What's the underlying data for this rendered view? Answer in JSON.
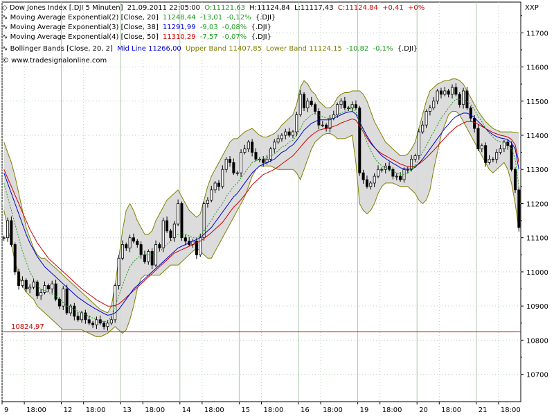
{
  "header": {
    "instrument_line": {
      "name": "Dow Jones Index [.DJI  5 Minuten]",
      "datetime": "21.09.2011 22:05:00",
      "open": "O:11121,63",
      "high": "H:11124,84",
      "low": "L:11117,43",
      "close": "C:11124,84",
      "change": "+0,41",
      "change_pct": "+0%"
    },
    "indicators": [
      {
        "label": "Moving Average Exponential(2) [Close, 20]",
        "value": "11248,44",
        "change": "-13,01",
        "change_pct": "-0,12%",
        "symbol": "{.DJI}",
        "color": "#1a9a1a"
      },
      {
        "label": "Moving Average Exponential(3) [Close, 38]",
        "value": "11291,99",
        "change": "-9,03",
        "change_pct": "-0,08%",
        "symbol": "{.DJI}",
        "color": "#0000d0"
      },
      {
        "label": "Moving Average Exponential(4) [Close, 50]",
        "value": "11310,29",
        "change": "-7,57",
        "change_pct": "-0,07%",
        "symbol": "{.DJI}",
        "color": "#cc0000"
      }
    ],
    "bollinger": {
      "label": "Bollinger Bands [Close, 20, 2]",
      "mid": "Mid Line 11266,00",
      "upper": "Upper Band 11407,85",
      "lower": "Lower Band 11124,15",
      "change": "-10,82",
      "change_pct": "-0,1%",
      "symbol": "{.DJI}",
      "mid_color": "#0000d0",
      "band_color": "#808000"
    },
    "copyright": "© www.tradesignalonline.com",
    "axis_tag": "XXP"
  },
  "chart_data": {
    "type": "line",
    "title": "Dow Jones Index [.DJI  5 Minuten]",
    "ylim": [
      10620,
      11790
    ],
    "y_ticks": [
      10700,
      10800,
      10900,
      11000,
      11100,
      11200,
      11300,
      11400,
      11500,
      11600,
      11700
    ],
    "y_tick_labels": [
      "10700",
      "10800",
      "10900",
      "11000",
      "11100",
      "11200",
      "11300",
      "11400",
      "11500",
      "11600",
      "11700"
    ],
    "x_ticks": [
      "9",
      "18:00",
      "12",
      "18:00",
      "13",
      "18:00",
      "14",
      "18:00",
      "15",
      "18:00",
      "16",
      "18:00",
      "19",
      "18:00",
      "20",
      "18:00",
      "21",
      "18:00"
    ],
    "x_tick_index": [
      0,
      6,
      16,
      22,
      32,
      38,
      48,
      54,
      64,
      70,
      80,
      86,
      96,
      102,
      112,
      118,
      128,
      134
    ],
    "day_separator_index": [
      16,
      32,
      48,
      64,
      80,
      96,
      112,
      128
    ],
    "grid": true,
    "reference_line": {
      "value": 10824.97,
      "label": "10824,97",
      "color": "#cc0000"
    },
    "series": [
      {
        "name": "Close",
        "color": "#000000",
        "values": [
          11100,
          11150,
          11080,
          11000,
          10960,
          10975,
          10950,
          10955,
          10970,
          10930,
          10940,
          10960,
          10950,
          10965,
          10920,
          10900,
          10950,
          10880,
          10900,
          10870,
          10860,
          10880,
          10860,
          10850,
          10845,
          10860,
          10850,
          10840,
          10850,
          10860,
          10960,
          11040,
          11080,
          11070,
          11100,
          11090,
          11080,
          11050,
          11030,
          11060,
          11020,
          11080,
          11070,
          11150,
          11120,
          11100,
          11140,
          11200,
          11100,
          11090,
          11080,
          11090,
          11050,
          11100,
          11200,
          11210,
          11240,
          11260,
          11250,
          11300,
          11330,
          11320,
          11290,
          11290,
          11350,
          11360,
          11380,
          11350,
          11330,
          11330,
          11320,
          11330,
          11360,
          11380,
          11390,
          11400,
          11410,
          11400,
          11410,
          11460,
          11520,
          11480,
          11500,
          11490,
          11470,
          11430,
          11430,
          11420,
          11450,
          11460,
          11490,
          11500,
          11480,
          11480,
          11490,
          11480,
          11290,
          11270,
          11250,
          11260,
          11280,
          11300,
          11300,
          11310,
          11300,
          11280,
          11280,
          11270,
          11300,
          11300,
          11330,
          11340,
          11410,
          11430,
          11470,
          11480,
          11500,
          11530,
          11520,
          11530,
          11520,
          11540,
          11520,
          11490,
          11530,
          11480,
          11450,
          11420,
          11360,
          11370,
          11320,
          11330,
          11330,
          11350,
          11360,
          11380,
          11370,
          11300,
          11240,
          11130
        ]
      },
      {
        "name": "Moving Average Exponential(2) [Close, 20]",
        "color": "#1a9a1a",
        "values": [
          11260,
          11220,
          11180,
          11140,
          11100,
          11060,
          11030,
          11000,
          10980,
          10960,
          10950,
          10945,
          10940,
          10935,
          10930,
          10920,
          10910,
          10900,
          10895,
          10890,
          10885,
          10880,
          10875,
          10870,
          10865,
          10860,
          10855,
          10855,
          10855,
          10870,
          10900,
          10930,
          10960,
          10990,
          11015,
          11030,
          11040,
          11050,
          11050,
          11050,
          11050,
          11055,
          11060,
          11070,
          11080,
          11090,
          11100,
          11110,
          11110,
          11110,
          11105,
          11100,
          11100,
          11105,
          11120,
          11135,
          11150,
          11170,
          11185,
          11200,
          11220,
          11235,
          11250,
          11260,
          11275,
          11290,
          11305,
          11320,
          11325,
          11330,
          11330,
          11335,
          11340,
          11345,
          11355,
          11365,
          11370,
          11380,
          11385,
          11400,
          11420,
          11440,
          11450,
          11460,
          11465,
          11460,
          11455,
          11450,
          11450,
          11455,
          11460,
          11465,
          11470,
          11475,
          11480,
          11470,
          11440,
          11410,
          11380,
          11355,
          11335,
          11320,
          11310,
          11305,
          11300,
          11295,
          11290,
          11285,
          11285,
          11290,
          11300,
          11310,
          11330,
          11350,
          11370,
          11390,
          11410,
          11430,
          11450,
          11465,
          11480,
          11495,
          11505,
          11505,
          11505,
          11500,
          11490,
          11475,
          11455,
          11440,
          11420,
          11405,
          11395,
          11385,
          11380,
          11380,
          11375,
          11360,
          11330,
          11250
        ]
      },
      {
        "name": "Moving Average Exponential(3) [Close, 38]",
        "color": "#0000d0",
        "values": [
          11290,
          11260,
          11230,
          11200,
          11170,
          11140,
          11110,
          11085,
          11065,
          11045,
          11030,
          11015,
          11005,
          10995,
          10985,
          10975,
          10965,
          10955,
          10945,
          10935,
          10925,
          10918,
          10910,
          10903,
          10896,
          10890,
          10884,
          10878,
          10873,
          10875,
          10880,
          10890,
          10905,
          10920,
          10935,
          10950,
          10960,
          10970,
          10980,
          10990,
          11000,
          11010,
          11020,
          11030,
          11040,
          11050,
          11060,
          11070,
          11075,
          11080,
          11085,
          11090,
          11095,
          11100,
          11110,
          11120,
          11130,
          11145,
          11160,
          11175,
          11190,
          11205,
          11220,
          11230,
          11245,
          11260,
          11275,
          11290,
          11300,
          11310,
          11315,
          11320,
          11325,
          11330,
          11340,
          11350,
          11355,
          11365,
          11372,
          11385,
          11400,
          11415,
          11425,
          11435,
          11440,
          11445,
          11445,
          11445,
          11445,
          11450,
          11455,
          11460,
          11465,
          11468,
          11470,
          11462,
          11440,
          11418,
          11398,
          11380,
          11365,
          11352,
          11340,
          11332,
          11325,
          11318,
          11312,
          11305,
          11302,
          11300,
          11302,
          11306,
          11318,
          11330,
          11345,
          11360,
          11375,
          11390,
          11405,
          11420,
          11432,
          11445,
          11455,
          11460,
          11465,
          11465,
          11460,
          11452,
          11440,
          11430,
          11420,
          11410,
          11402,
          11396,
          11392,
          11390,
          11387,
          11378,
          11360,
          11300
        ]
      },
      {
        "name": "Moving Average Exponential(4) [Close, 50]",
        "color": "#cc0000",
        "values": [
          11300,
          11275,
          11250,
          11225,
          11200,
          11175,
          11150,
          11125,
          11105,
          11085,
          11070,
          11055,
          11040,
          11030,
          11020,
          11010,
          11000,
          10990,
          10980,
          10970,
          10960,
          10950,
          10942,
          10934,
          10926,
          10918,
          10912,
          10906,
          10900,
          10900,
          10902,
          10906,
          10915,
          10925,
          10935,
          10945,
          10955,
          10965,
          10975,
          10985,
          10995,
          11005,
          11015,
          11025,
          11035,
          11045,
          11055,
          11060,
          11065,
          11070,
          11075,
          11080,
          11085,
          11090,
          11098,
          11106,
          11115,
          11125,
          11135,
          11145,
          11160,
          11175,
          11190,
          11200,
          11212,
          11225,
          11240,
          11255,
          11265,
          11275,
          11285,
          11290,
          11295,
          11300,
          11308,
          11316,
          11324,
          11332,
          11340,
          11352,
          11365,
          11378,
          11390,
          11400,
          11408,
          11415,
          11418,
          11420,
          11422,
          11426,
          11430,
          11436,
          11440,
          11444,
          11448,
          11444,
          11428,
          11410,
          11392,
          11376,
          11364,
          11354,
          11346,
          11340,
          11334,
          11328,
          11322,
          11316,
          11312,
          11308,
          11308,
          11310,
          11316,
          11324,
          11334,
          11345,
          11356,
          11368,
          11380,
          11392,
          11404,
          11414,
          11424,
          11430,
          11436,
          11440,
          11440,
          11438,
          11432,
          11426,
          11420,
          11414,
          11408,
          11404,
          11400,
          11398,
          11395,
          11388,
          11372,
          11320
        ]
      },
      {
        "name": "Upper Band",
        "color": "#808000",
        "values": [
          11380,
          11350,
          11320,
          11280,
          11230,
          11180,
          11130,
          11100,
          11070,
          11050,
          11040,
          11040,
          11030,
          11020,
          11010,
          11000,
          10990,
          10980,
          10970,
          10960,
          10950,
          10940,
          10930,
          10920,
          10910,
          10900,
          10890,
          10885,
          10880,
          10900,
          10960,
          11040,
          11120,
          11180,
          11200,
          11180,
          11150,
          11130,
          11110,
          11110,
          11120,
          11150,
          11170,
          11190,
          11210,
          11220,
          11230,
          11240,
          11220,
          11200,
          11180,
          11170,
          11160,
          11170,
          11210,
          11250,
          11280,
          11300,
          11320,
          11340,
          11360,
          11380,
          11390,
          11390,
          11400,
          11410,
          11415,
          11420,
          11410,
          11400,
          11395,
          11395,
          11400,
          11405,
          11415,
          11430,
          11440,
          11450,
          11460,
          11490,
          11540,
          11560,
          11550,
          11530,
          11520,
          11500,
          11490,
          11480,
          11480,
          11490,
          11510,
          11520,
          11525,
          11525,
          11530,
          11530,
          11530,
          11520,
          11500,
          11470,
          11440,
          11420,
          11400,
          11380,
          11370,
          11360,
          11350,
          11340,
          11340,
          11345,
          11360,
          11380,
          11420,
          11460,
          11500,
          11530,
          11540,
          11550,
          11555,
          11560,
          11560,
          11565,
          11565,
          11560,
          11550,
          11530,
          11510,
          11490,
          11470,
          11455,
          11440,
          11430,
          11420,
          11415,
          11410,
          11410,
          11410,
          11410,
          11408,
          11407
        ]
      },
      {
        "name": "Lower Band",
        "color": "#808000",
        "values": [
          11180,
          11130,
          11080,
          11030,
          10990,
          10960,
          10940,
          10930,
          10920,
          10900,
          10890,
          10880,
          10870,
          10860,
          10850,
          10840,
          10830,
          10830,
          10830,
          10830,
          10830,
          10830,
          10825,
          10820,
          10815,
          10810,
          10810,
          10815,
          10820,
          10830,
          10840,
          10830,
          10820,
          10830,
          10860,
          10900,
          10950,
          10980,
          10990,
          10990,
          10990,
          10990,
          10990,
          11000,
          11010,
          11020,
          11020,
          11020,
          11030,
          11040,
          11050,
          11060,
          11070,
          11060,
          11050,
          11040,
          11040,
          11060,
          11080,
          11100,
          11120,
          11140,
          11160,
          11180,
          11200,
          11220,
          11250,
          11280,
          11300,
          11310,
          11310,
          11310,
          11310,
          11305,
          11300,
          11300,
          11300,
          11300,
          11300,
          11290,
          11270,
          11300,
          11330,
          11360,
          11380,
          11390,
          11400,
          11405,
          11405,
          11400,
          11390,
          11390,
          11390,
          11395,
          11400,
          11320,
          11200,
          11180,
          11170,
          11180,
          11200,
          11230,
          11250,
          11260,
          11260,
          11260,
          11255,
          11250,
          11250,
          11250,
          11240,
          11230,
          11210,
          11200,
          11210,
          11240,
          11300,
          11350,
          11400,
          11430,
          11460,
          11470,
          11470,
          11460,
          11440,
          11420,
          11400,
          11380,
          11360,
          11340,
          11320,
          11300,
          11290,
          11300,
          11310,
          11320,
          11300,
          11260,
          11200,
          11124
        ]
      }
    ]
  },
  "colors": {
    "background": "#ffffff",
    "band_fill": "#d8d8d8",
    "band_outline": "#808000",
    "grid": "#b8d0b8",
    "separator": "#a8c8a8",
    "candle_up": "#ffffff",
    "candle_down": "#000000",
    "wick": "#000000",
    "axis": "#000000",
    "text": "#000000",
    "green_text": "#1a9a1a",
    "red_text": "#cc0000"
  }
}
